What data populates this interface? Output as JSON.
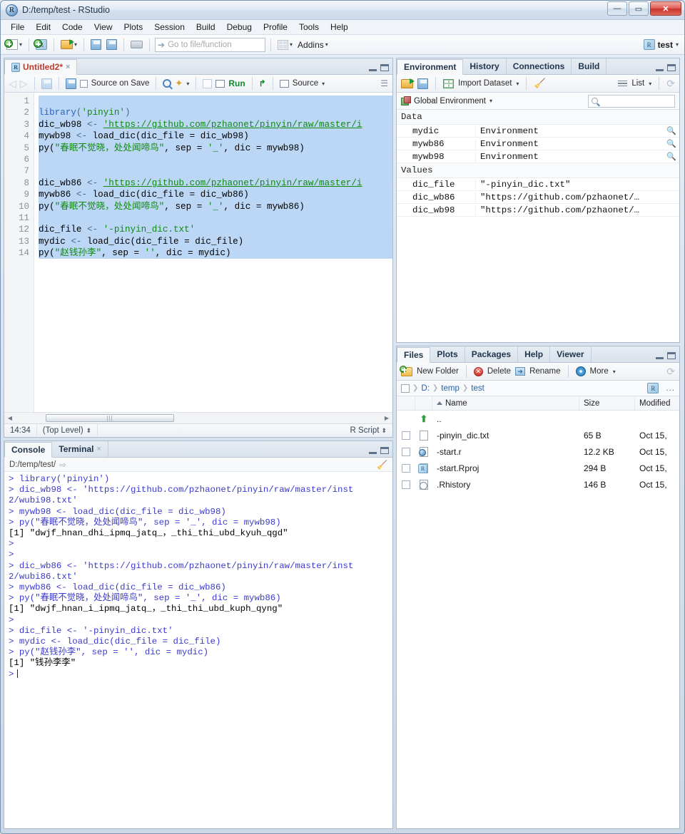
{
  "window": {
    "title": "D:/temp/test - RStudio",
    "app_icon": "R",
    "minimize": "—",
    "maximize": "▭",
    "close": "✕"
  },
  "menubar": {
    "items": [
      "File",
      "Edit",
      "Code",
      "View",
      "Plots",
      "Session",
      "Build",
      "Debug",
      "Profile",
      "Tools",
      "Help"
    ]
  },
  "toolbar": {
    "new_file": "new-file-icon",
    "new_project": "new-project-icon",
    "open_file": "open-file-icon",
    "save": "save-icon",
    "save_all": "save-all-icon",
    "print": "print-icon",
    "goto_placeholder": "Go to file/function",
    "addins_label": "Addins",
    "project_name": "test"
  },
  "source": {
    "tab_label": "Untitled2*",
    "tab_close": "×",
    "toolbar": {
      "back": "◁",
      "forward": "▷",
      "popout": "popout-icon",
      "save": "save-icon",
      "source_on_save": "Source on Save",
      "find": "find-icon",
      "magic": "code-tools-icon",
      "compile_report": "compile-report-icon",
      "run": "Run",
      "rerun": "re-run-icon",
      "source": "Source",
      "outline": "outline-icon"
    },
    "lines": [
      {
        "n": 1,
        "selected": true,
        "segments": []
      },
      {
        "n": 2,
        "selected": true,
        "segments": [
          {
            "t": "library",
            "c": "fn"
          },
          {
            "t": "(",
            "c": "op"
          },
          {
            "t": "'pinyin'",
            "c": "str"
          },
          {
            "t": ")",
            "c": "op"
          }
        ]
      },
      {
        "n": 3,
        "selected": true,
        "segments": [
          {
            "t": "dic_wb98 ",
            "c": "plain"
          },
          {
            "t": "<- ",
            "c": "op"
          },
          {
            "t": "'https://github.com/pzhaonet/pinyin/raw/master/i",
            "c": "url"
          }
        ]
      },
      {
        "n": 4,
        "selected": true,
        "segments": [
          {
            "t": "mywb98 ",
            "c": "plain"
          },
          {
            "t": "<- ",
            "c": "op"
          },
          {
            "t": "load_dic(dic_file = dic_wb98)",
            "c": "plain"
          }
        ]
      },
      {
        "n": 5,
        "selected": true,
        "segments": [
          {
            "t": "py(",
            "c": "plain"
          },
          {
            "t": "\"春眠不觉晓，处处闻啼鸟\"",
            "c": "str"
          },
          {
            "t": ", sep = ",
            "c": "plain"
          },
          {
            "t": "'_'",
            "c": "str"
          },
          {
            "t": ", dic = mywb98)",
            "c": "plain"
          }
        ]
      },
      {
        "n": 6,
        "selected": true,
        "segments": []
      },
      {
        "n": 7,
        "selected": true,
        "segments": []
      },
      {
        "n": 8,
        "selected": true,
        "segments": [
          {
            "t": "dic_wb86 ",
            "c": "plain"
          },
          {
            "t": "<- ",
            "c": "op"
          },
          {
            "t": "'https://github.com/pzhaonet/pinyin/raw/master/i",
            "c": "url"
          }
        ]
      },
      {
        "n": 9,
        "selected": true,
        "segments": [
          {
            "t": "mywb86 ",
            "c": "plain"
          },
          {
            "t": "<- ",
            "c": "op"
          },
          {
            "t": "load_dic(dic_file = dic_wb86)",
            "c": "plain"
          }
        ]
      },
      {
        "n": 10,
        "selected": true,
        "segments": [
          {
            "t": "py(",
            "c": "plain"
          },
          {
            "t": "\"春眠不觉晓，处处闻啼鸟\"",
            "c": "str"
          },
          {
            "t": ", sep = ",
            "c": "plain"
          },
          {
            "t": "'_'",
            "c": "str"
          },
          {
            "t": ", dic = mywb86)",
            "c": "plain"
          }
        ]
      },
      {
        "n": 11,
        "selected": true,
        "segments": []
      },
      {
        "n": 12,
        "selected": true,
        "segments": [
          {
            "t": "dic_file ",
            "c": "plain"
          },
          {
            "t": "<- ",
            "c": "op"
          },
          {
            "t": "'-pinyin_dic.txt'",
            "c": "str"
          }
        ]
      },
      {
        "n": 13,
        "selected": true,
        "segments": [
          {
            "t": "mydic ",
            "c": "plain"
          },
          {
            "t": "<- ",
            "c": "op"
          },
          {
            "t": "load_dic(dic_file = dic_file)",
            "c": "plain"
          }
        ]
      },
      {
        "n": 14,
        "selected": true,
        "segments": [
          {
            "t": "py(",
            "c": "plain"
          },
          {
            "t": "\"赵钱孙李\"",
            "c": "str"
          },
          {
            "t": ", sep = ",
            "c": "plain"
          },
          {
            "t": "''",
            "c": "str"
          },
          {
            "t": ", dic = mydic)",
            "c": "plain"
          }
        ]
      }
    ],
    "status": {
      "cursor": "14:34",
      "scope": "(Top Level)",
      "file_type": "R Script"
    }
  },
  "console": {
    "tabs": [
      {
        "label": "Console",
        "active": true,
        "closable": false
      },
      {
        "label": "Terminal",
        "active": false,
        "closable": true,
        "close": "×"
      }
    ],
    "path": "D:/temp/test/",
    "path_arrow": "⇨",
    "broom": "broom-icon",
    "lines": [
      {
        "type": "cmd",
        "text": "> library('pinyin')"
      },
      {
        "type": "cmd",
        "text": "> dic_wb98 <- 'https://github.com/pzhaonet/pinyin/raw/master/inst"
      },
      {
        "type": "cmd",
        "text": "2/wubi98.txt'"
      },
      {
        "type": "cmd",
        "text": "> mywb98 <- load_dic(dic_file = dic_wb98)"
      },
      {
        "type": "cmd",
        "text": "> py(\"春眠不觉晓，处处闻啼鸟\", sep = '_', dic = mywb98)"
      },
      {
        "type": "out",
        "text": "[1] \"dwjf_hnan_dhi_ipmq_jatq_，_thi_thi_ubd_kyuh_qgd\""
      },
      {
        "type": "cmd",
        "text": "> "
      },
      {
        "type": "cmd",
        "text": "> "
      },
      {
        "type": "cmd",
        "text": "> dic_wb86 <- 'https://github.com/pzhaonet/pinyin/raw/master/inst"
      },
      {
        "type": "cmd",
        "text": "2/wubi86.txt'"
      },
      {
        "type": "cmd",
        "text": "> mywb86 <- load_dic(dic_file = dic_wb86)"
      },
      {
        "type": "cmd",
        "text": "> py(\"春眠不觉晓，处处闻啼鸟\", sep = '_', dic = mywb86)"
      },
      {
        "type": "out",
        "text": "[1] \"dwjf_hnan_i_ipmq_jatq_，_thi_thi_ubd_kuph_qyng\""
      },
      {
        "type": "cmd",
        "text": "> "
      },
      {
        "type": "cmd",
        "text": "> dic_file <- '-pinyin_dic.txt'"
      },
      {
        "type": "cmd",
        "text": "> mydic <- load_dic(dic_file = dic_file)"
      },
      {
        "type": "cmd",
        "text": "> py(\"赵钱孙李\", sep = '', dic = mydic)"
      },
      {
        "type": "out",
        "text": "[1] \"钱孙李李\""
      }
    ],
    "prompt": ">"
  },
  "environment": {
    "tabs": [
      {
        "label": "Environment",
        "active": true
      },
      {
        "label": "History",
        "active": false
      },
      {
        "label": "Connections",
        "active": false
      },
      {
        "label": "Build",
        "active": false
      }
    ],
    "toolbar": {
      "load": "load-workspace-icon",
      "save": "save-workspace-icon",
      "import_dataset": "Import Dataset",
      "clear": "clear-objects-icon",
      "view_mode": "List",
      "refresh": "refresh-icon"
    },
    "scope": "Global Environment",
    "search_placeholder": "",
    "groups": [
      {
        "name": "Data",
        "rows": [
          {
            "name": "mydic",
            "value": "Environment"
          },
          {
            "name": "mywb86",
            "value": "Environment"
          },
          {
            "name": "mywb98",
            "value": "Environment"
          }
        ]
      },
      {
        "name": "Values",
        "rows": [
          {
            "name": "dic_file",
            "value": "\"-pinyin_dic.txt\""
          },
          {
            "name": "dic_wb86",
            "value": "\"https://github.com/pzhaonet/…"
          },
          {
            "name": "dic_wb98",
            "value": "\"https://github.com/pzhaonet/…"
          }
        ]
      }
    ]
  },
  "files": {
    "tabs": [
      {
        "label": "Files",
        "active": true
      },
      {
        "label": "Plots",
        "active": false
      },
      {
        "label": "Packages",
        "active": false
      },
      {
        "label": "Help",
        "active": false
      },
      {
        "label": "Viewer",
        "active": false
      }
    ],
    "toolbar": {
      "new_folder": "New Folder",
      "delete": "Delete",
      "rename": "Rename",
      "more": "More",
      "refresh": "refresh-icon"
    },
    "breadcrumb": [
      "D:",
      "temp",
      "test"
    ],
    "breadcrumb_more": "...",
    "columns": [
      "Name",
      "Size",
      "Modified"
    ],
    "rows": [
      {
        "icon": "up-folder-icon",
        "name": "..",
        "size": "",
        "modified": "",
        "checkbox": false
      },
      {
        "icon": "text-file-icon",
        "name": "-pinyin_dic.txt",
        "size": "65 B",
        "modified": "Oct 15, ",
        "checkbox": true
      },
      {
        "icon": "r-file-icon",
        "name": "-start.r",
        "size": "12.2 KB",
        "modified": "Oct 15, ",
        "checkbox": true
      },
      {
        "icon": "rproj-file-icon",
        "name": "-start.Rproj",
        "size": "294 B",
        "modified": "Oct 15, ",
        "checkbox": true
      },
      {
        "icon": "history-file-icon",
        "name": ".Rhistory",
        "size": "146 B",
        "modified": "Oct 15, ",
        "checkbox": true
      }
    ]
  }
}
